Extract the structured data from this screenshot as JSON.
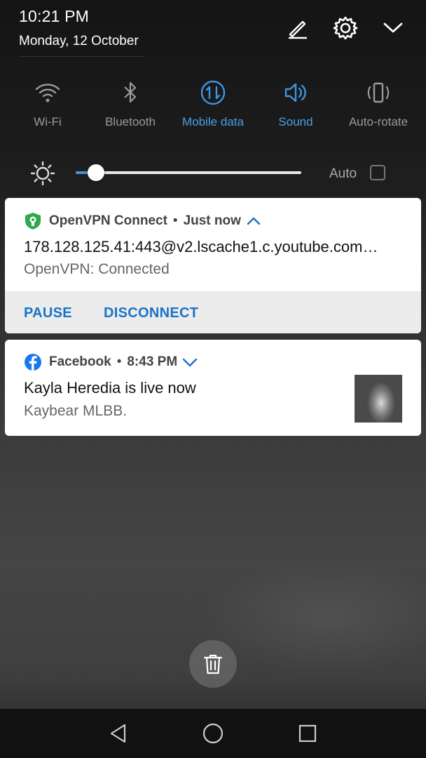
{
  "status": {
    "time": "10:21 PM",
    "date": "Monday, 12 October"
  },
  "header_icons": [
    "edit-icon",
    "settings-icon",
    "collapse-chevron-icon"
  ],
  "quick_settings": [
    {
      "label": "Wi-Fi",
      "icon": "wifi-icon",
      "active": false
    },
    {
      "label": "Bluetooth",
      "icon": "bluetooth-icon",
      "active": false
    },
    {
      "label": "Mobile data",
      "icon": "mobile-data-icon",
      "active": true
    },
    {
      "label": "Sound",
      "icon": "sound-icon",
      "active": true
    },
    {
      "label": "Auto-rotate",
      "icon": "auto-rotate-icon",
      "active": false
    }
  ],
  "brightness": {
    "level": 0.09,
    "auto_label": "Auto",
    "auto_checked": false
  },
  "notifications": [
    {
      "app": "OpenVPN Connect",
      "separator": "•",
      "when": "Just now",
      "title": "178.128.125.41:443@v2.lscache1.c.youtube.com…",
      "text": "OpenVPN: Connected",
      "expanded": true,
      "actions": [
        "PAUSE",
        "DISCONNECT"
      ],
      "icon": "openvpn-shield-icon"
    },
    {
      "app": "Facebook",
      "separator": "•",
      "when": "8:43 PM",
      "title": "Kayla Heredia is live now",
      "text": "Kaybear MLBB.",
      "expanded": false,
      "icon": "facebook-icon"
    }
  ],
  "colors": {
    "accent": "#3d95e0",
    "active_label": "#4a9fe6",
    "action_text": "#1a73c8",
    "openvpn_green": "#2fa84f",
    "facebook_blue": "#1877f2"
  },
  "nav": [
    "back-icon",
    "home-icon",
    "recents-icon"
  ]
}
